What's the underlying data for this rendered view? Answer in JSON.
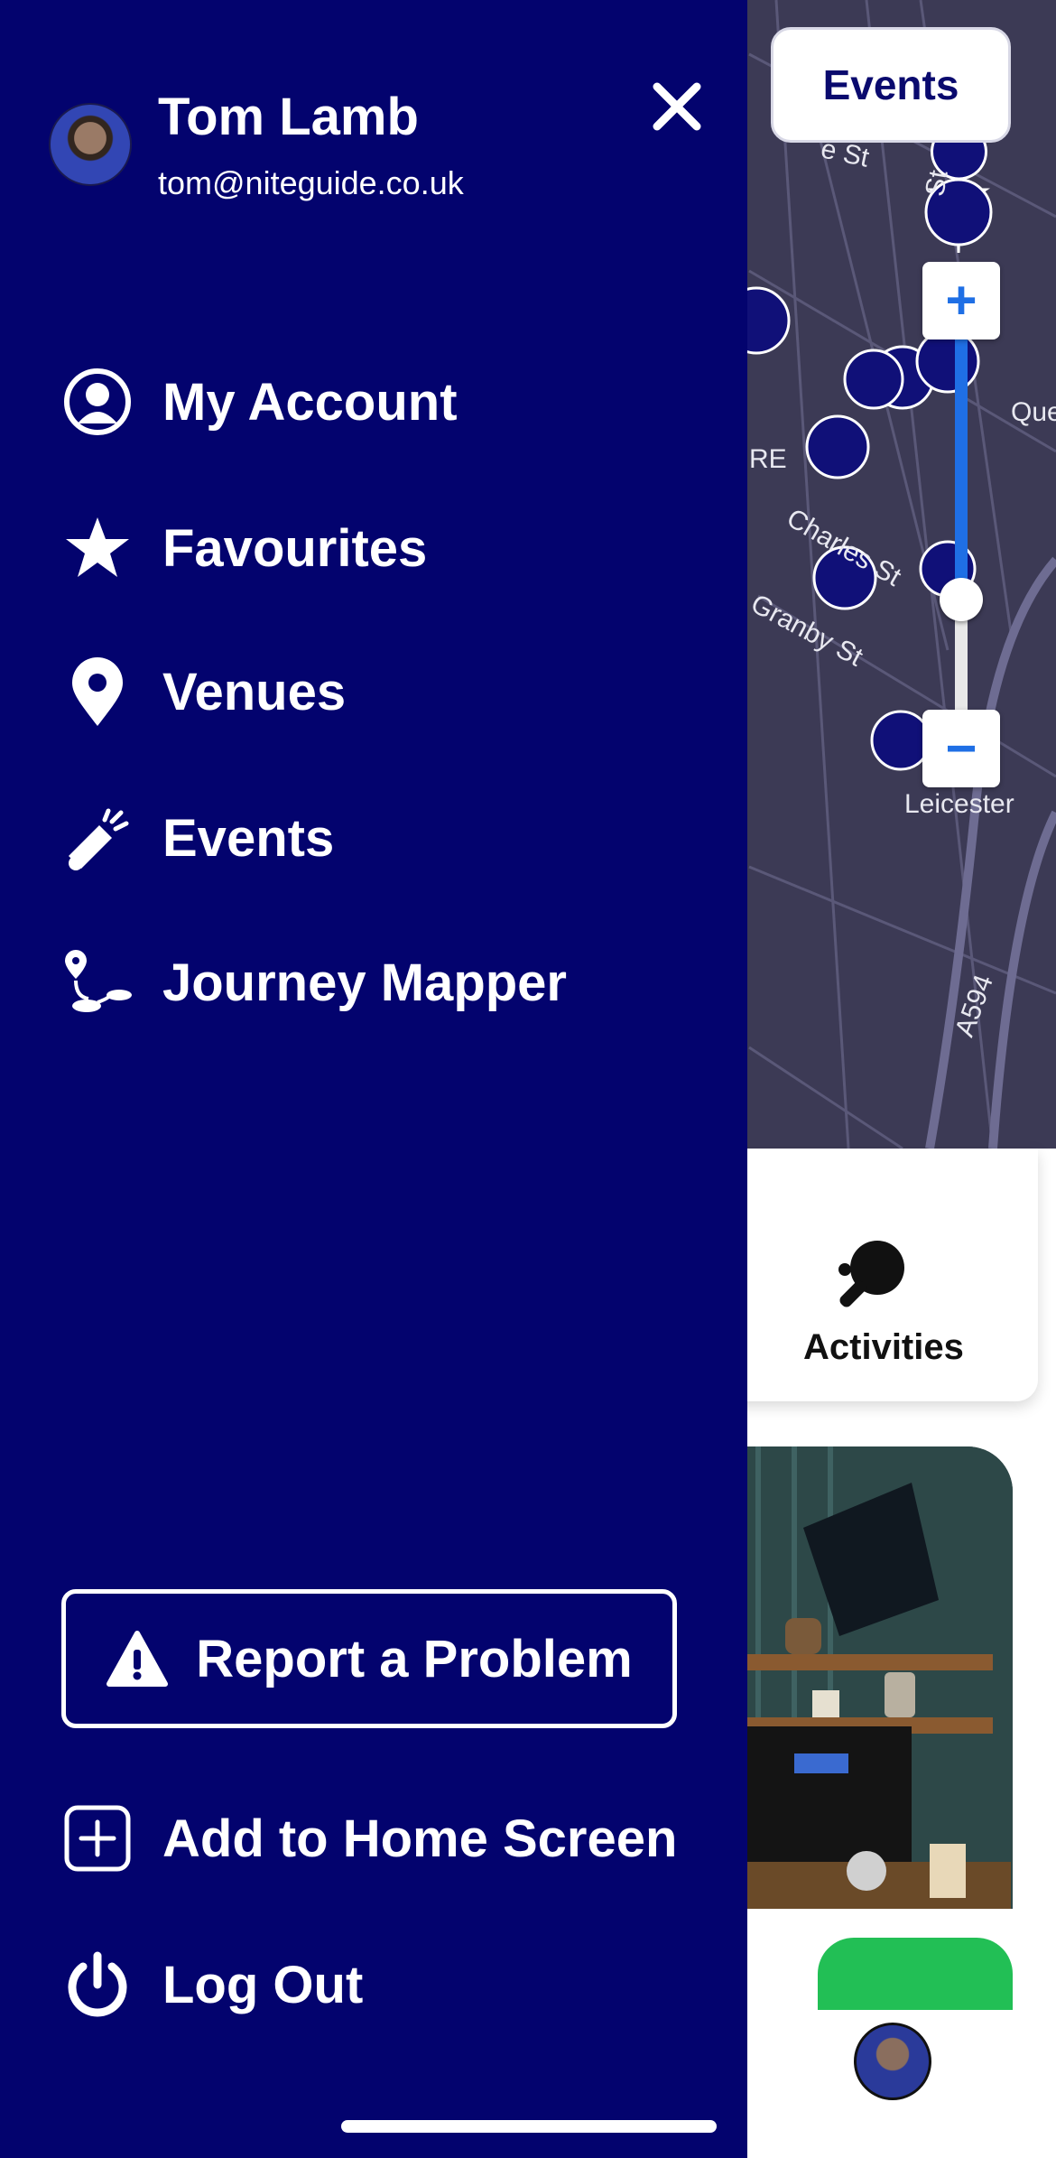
{
  "user": {
    "name": "Tom Lamb",
    "email": "tom@niteguide.co.uk"
  },
  "menu": {
    "items": [
      {
        "label": "My Account",
        "icon": "account-circle-icon"
      },
      {
        "label": "Favourites",
        "icon": "star-icon"
      },
      {
        "label": "Venues",
        "icon": "map-pin-icon"
      },
      {
        "label": "Events",
        "icon": "party-popper-icon"
      },
      {
        "label": "Journey Mapper",
        "icon": "route-icon"
      }
    ],
    "report_problem": "Report a Problem",
    "add_home": "Add to Home Screen",
    "logout": "Log Out"
  },
  "map": {
    "events_chip": "Events",
    "zoom_in": "+",
    "zoom_out": "−",
    "streets": [
      "Charles St",
      "Granby St",
      "Leicester",
      "A594",
      "Que",
      "RE",
      "e St",
      "St"
    ]
  },
  "background": {
    "card_label": "Activities"
  },
  "colors": {
    "drawer": "#03036e",
    "map": "#3c3a55",
    "zoom_accent": "#1f6fe5",
    "green": "#22bf55"
  }
}
